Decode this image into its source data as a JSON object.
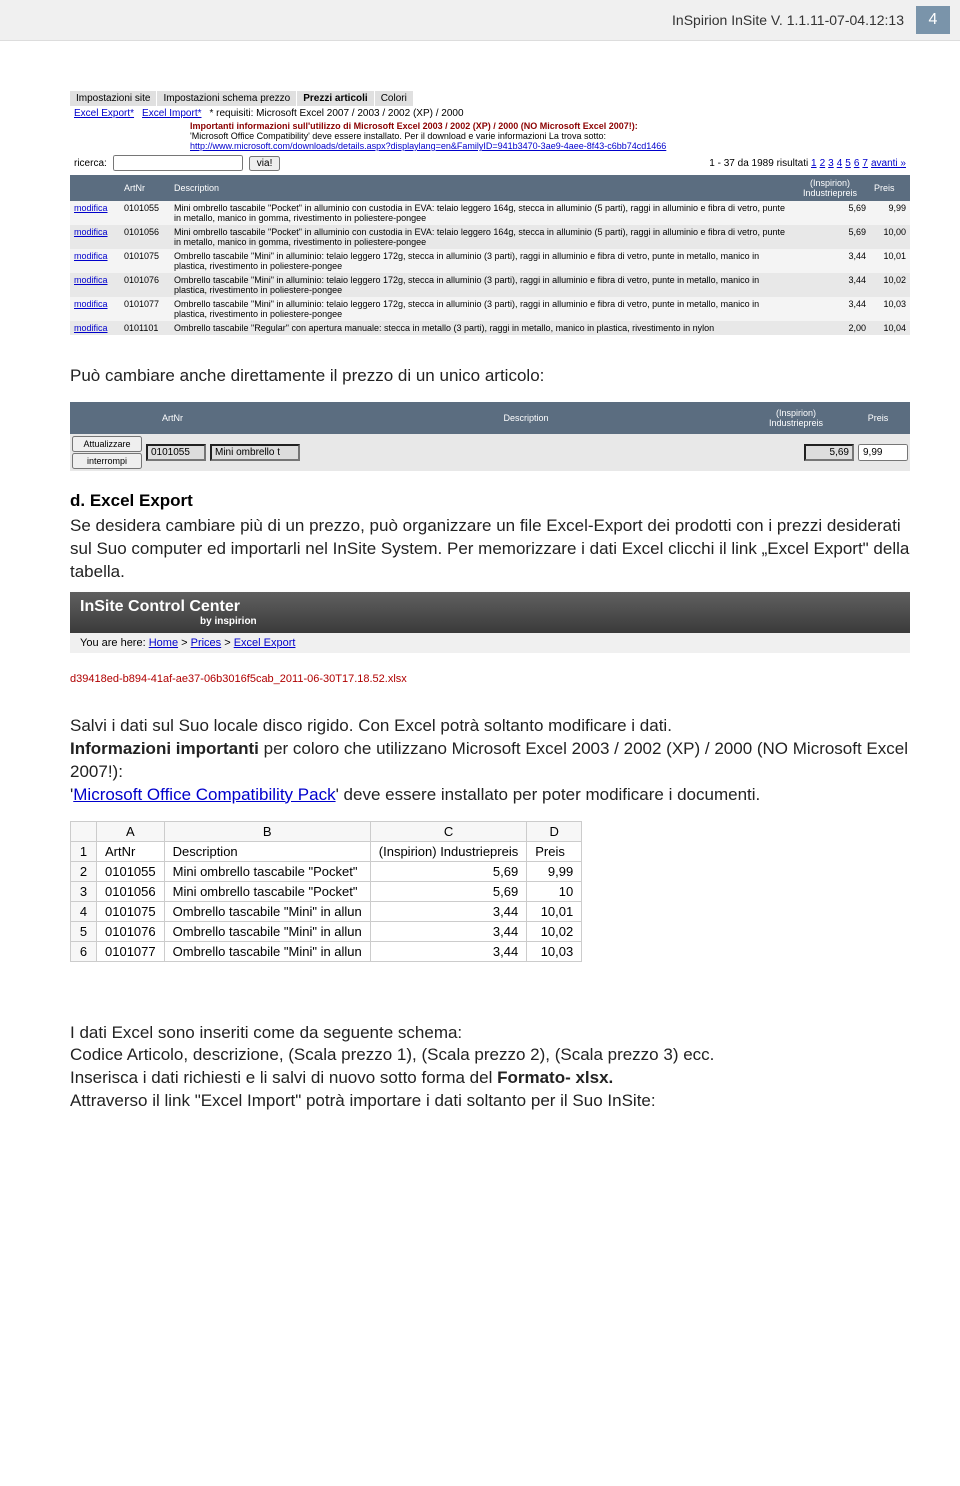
{
  "header": {
    "title": "InSpirion InSite V. 1.1.11-07-04.12:13",
    "page_number": "4"
  },
  "tabs": {
    "t1": "Impostazioni site",
    "t2": "Impostazioni schema prezzo",
    "t3": "Prezzi articoli",
    "t4": "Colori"
  },
  "export_row": {
    "excel_export": "Excel Export*",
    "excel_import": "Excel Import*",
    "req": "* requisiti: Microsoft Excel 2007 / 2003 / 2002 (XP) / 2000",
    "warn": "Importanti informazioni sull'utilizzo di Microsoft Excel 2003 / 2002 (XP) / 2000 (NO Microsoft Excel 2007!):",
    "info": "'Microsoft Office Compatibility' deve essere installato. Per il download e varie informazioni La trova sotto:",
    "url": "http://www.microsoft.com/downloads/details.aspx?displaylang=en&FamilyID=941b3470-3ae9-4aee-8f43-c6bb74cd1466"
  },
  "search": {
    "label": "ricerca:",
    "button": "via!",
    "results": "1 - 37 da 1989 risultati",
    "pager": [
      "1",
      "2",
      "3",
      "4",
      "5",
      "6",
      "7",
      "avanti »"
    ]
  },
  "table": {
    "headers": {
      "c0": "",
      "c1": "ArtNr",
      "c2": "Description",
      "c3": "(Inspirion) Industriepreis",
      "c4": "Preis"
    },
    "rows": [
      {
        "mod": "modifica",
        "art": "0101055",
        "desc": "Mini ombrello tascabile \"Pocket\" in alluminio con custodia in EVA: telaio leggero 164g, stecca in alluminio (5 parti), raggi in alluminio e fibra di vetro, punte in metallo, manico in gomma, rivestimento in poliestere-pongee",
        "ind": "5,69",
        "pr": "9,99"
      },
      {
        "mod": "modifica",
        "art": "0101056",
        "desc": "Mini ombrello tascabile \"Pocket\" in alluminio con custodia in EVA: telaio leggero 164g, stecca in alluminio (5 parti), raggi in alluminio e fibra di vetro, punte in metallo, manico in gomma, rivestimento in poliestere-pongee",
        "ind": "5,69",
        "pr": "10,00"
      },
      {
        "mod": "modifica",
        "art": "0101075",
        "desc": "Ombrello tascabile \"Mini\" in alluminio: telaio leggero 172g, stecca in alluminio (3 parti), raggi in alluminio e fibra di vetro, punte in metallo, manico in plastica, rivestimento in poliestere-pongee",
        "ind": "3,44",
        "pr": "10,01"
      },
      {
        "mod": "modifica",
        "art": "0101076",
        "desc": "Ombrello tascabile \"Mini\" in alluminio: telaio leggero 172g, stecca in alluminio (3 parti), raggi in alluminio e fibra di vetro, punte in metallo, manico in plastica, rivestimento in poliestere-pongee",
        "ind": "3,44",
        "pr": "10,02"
      },
      {
        "mod": "modifica",
        "art": "0101077",
        "desc": "Ombrello tascabile \"Mini\" in alluminio: telaio leggero 172g, stecca in alluminio (3 parti), raggi in alluminio e fibra di vetro, punte in metallo, manico in plastica, rivestimento in poliestere-pongee",
        "ind": "3,44",
        "pr": "10,03"
      },
      {
        "mod": "modifica",
        "art": "0101101",
        "desc": "Ombrello tascabile \"Regular\" con apertura manuale: stecca in metallo (3 parti), raggi in metallo, manico in plastica, rivestimento in nylon",
        "ind": "2,00",
        "pr": "10,04"
      }
    ]
  },
  "body": {
    "intro": "Può cambiare anche direttamente il prezzo di un unico articolo:"
  },
  "edit": {
    "hdr_art": "ArtNr",
    "hdr_desc": "Description",
    "hdr_ind": "(Inspirion) Industriepreis",
    "hdr_pr": "Preis",
    "btn_update": "Attualizzare",
    "btn_cancel": "interrompi",
    "val_art": "0101055",
    "val_desc": "Mini ombrello t",
    "val_ind": "5,69",
    "val_pr": "9,99"
  },
  "section_d": {
    "title": "d. Excel Export",
    "p1": "Se desidera cambiare più di un prezzo, può organizzare un file Excel-Export dei prodotti con i prezzi desiderati sul Suo computer ed importarli nel InSite System. Per memorizzare i dati Excel clicchi il link „Excel Export\" della tabella."
  },
  "cc": {
    "title": "InSite Control Center",
    "by": "by inspirion",
    "breadcrumb_label": "You are here:",
    "crumb1": "Home",
    "crumb2": "Prices",
    "crumb3": "Excel Export"
  },
  "xlsx": "d39418ed-b894-41af-ae37-06b3016f5cab_2011-06-30T17.18.52.xlsx",
  "after_cc": {
    "p1": "Salvi i dati sul Suo locale disco rigido. Con Excel potrà soltanto modificare i dati.",
    "p2a": "Informazioni importanti",
    "p2b": " per coloro che utilizzano Microsoft Excel 2003 / 2002 (XP) / 2000 (NO Microsoft Excel 2007!):",
    "p3a": "'",
    "p3b": "Microsoft Office Compatibility Pack",
    "p3c": "' deve essere installato per poter modificare i documenti."
  },
  "excel_shot": {
    "cols": [
      "",
      "A",
      "B",
      "C",
      "D"
    ],
    "rows": [
      [
        "1",
        "ArtNr",
        "Description",
        "(Inspirion) Industriepreis",
        "Preis"
      ],
      [
        "2",
        "0101055",
        "Mini ombrello tascabile \"Pocket\"",
        "5,69",
        "9,99"
      ],
      [
        "3",
        "0101056",
        "Mini ombrello tascabile \"Pocket\"",
        "5,69",
        "10"
      ],
      [
        "4",
        "0101075",
        "Ombrello tascabile \"Mini\" in allun",
        "3,44",
        "10,01"
      ],
      [
        "5",
        "0101076",
        "Ombrello tascabile \"Mini\" in allun",
        "3,44",
        "10,02"
      ],
      [
        "6",
        "0101077",
        "Ombrello tascabile \"Mini\" in allun",
        "3,44",
        "10,03"
      ]
    ]
  },
  "footer": {
    "p1": "I dati Excel sono inseriti come da seguente schema:",
    "p2": "Codice Articolo, descrizione, (Scala prezzo 1), (Scala prezzo 2), (Scala prezzo 3) ecc.",
    "p3a": "Inserisca i dati richiesti e li salvi di nuovo sotto forma del ",
    "p3b": "Formato- xlsx.",
    "p4": "Attraverso il link \"Excel Import\" potrà importare i dati soltanto per il Suo InSite:"
  }
}
